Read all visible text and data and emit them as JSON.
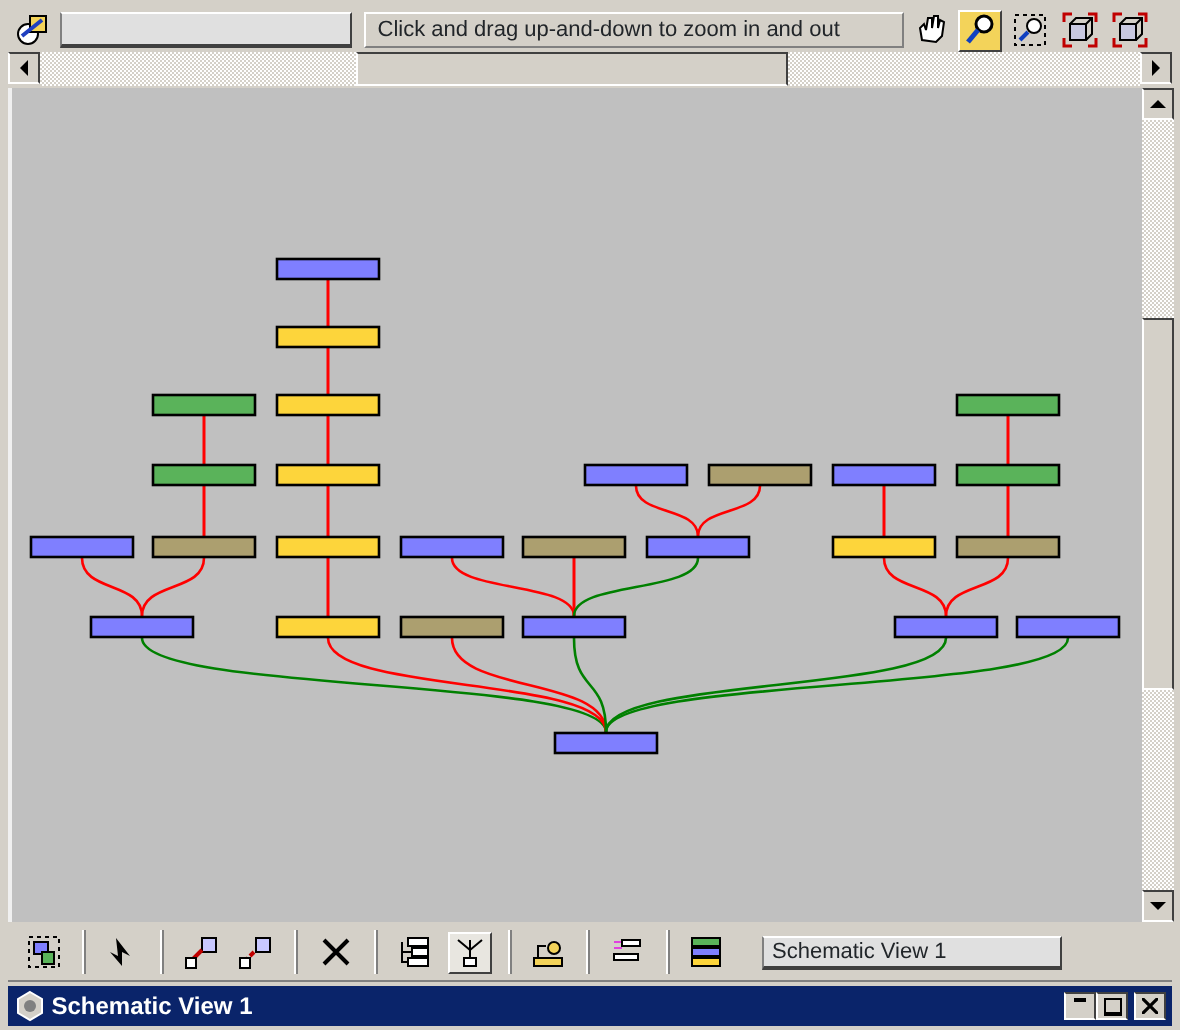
{
  "status_bar": {
    "field_text": "Click and drag up-and-down to zoom in and out"
  },
  "view_tools": [
    {
      "kind": "pan",
      "selected": false
    },
    {
      "kind": "zoom",
      "selected": true
    },
    {
      "kind": "zoom-region",
      "selected": false
    },
    {
      "kind": "zoom-extents-selected",
      "selected": false
    },
    {
      "kind": "zoom-extents",
      "selected": false
    }
  ],
  "graph": {
    "color": "#7f7fff",
    "children": [
      {
        "color": "#7f7fff",
        "link": {
          "color": "#008000"
        },
        "children": [
          {
            "color": "#7f7fff",
            "link": {
              "color": "#ff0000"
            }
          },
          {
            "color": "#ac9f6f",
            "link": {
              "color": "#ff0000"
            },
            "children": [
              {
                "color": "#5ab35a",
                "link": {
                  "color": "#ff0000"
                },
                "children": [
                  {
                    "color": "#5ab35a",
                    "link": {
                      "color": "#ff0000"
                    }
                  }
                ]
              }
            ]
          }
        ]
      },
      {
        "color": "#fdd53b",
        "link": {
          "color": "#ff0000"
        },
        "children": [
          {
            "color": "#fdd53b",
            "link": {
              "color": "#ff0000"
            },
            "children": [
              {
                "color": "#fdd53b",
                "link": {
                  "color": "#ff0000"
                },
                "children": [
                  {
                    "color": "#fdd53b",
                    "link": {
                      "color": "#ff0000"
                    },
                    "children": [
                      {
                        "color": "#fdd53b",
                        "link": {
                          "color": "#ff0000"
                        },
                        "children": [
                          {
                            "color": "#7f7fff",
                            "link": {
                              "color": "#ff0000"
                            }
                          }
                        ]
                      }
                    ]
                  }
                ]
              }
            ]
          }
        ]
      },
      {
        "color": "#ac9f6f",
        "link": {
          "color": "#ff0000"
        }
      },
      {
        "color": "#7f7fff",
        "link": {
          "color": "#008000"
        },
        "children": [
          {
            "color": "#7f7fff",
            "link": {
              "color": "#ff0000"
            }
          },
          {
            "color": "#ac9f6f",
            "link": {
              "color": "#ff0000"
            }
          },
          {
            "color": "#7f7fff",
            "link": {
              "color": "#008000"
            },
            "children": [
              {
                "color": "#7f7fff",
                "link": {
                  "color": "#ff0000"
                }
              },
              {
                "color": "#ac9f6f",
                "link": {
                  "color": "#ff0000"
                }
              }
            ]
          }
        ]
      },
      {
        "color": "#7f7fff",
        "link": {
          "color": "#008000"
        },
        "children": [
          {
            "color": "#fdd53b",
            "link": {
              "color": "#ff0000"
            },
            "children": [
              {
                "color": "#7f7fff",
                "link": {
                  "color": "#ff0000"
                }
              }
            ]
          },
          {
            "color": "#ac9f6f",
            "link": {
              "color": "#ff0000"
            },
            "children": [
              {
                "color": "#5ab35a",
                "link": {
                  "color": "#ff0000"
                },
                "children": [
                  {
                    "color": "#5ab35a",
                    "link": {
                      "color": "#ff0000"
                    }
                  }
                ]
              }
            ]
          }
        ]
      },
      {
        "color": "#7f7fff",
        "link": {
          "color": "#008000"
        }
      }
    ]
  },
  "toolbar": [
    [
      {
        "kind": "display",
        "selected": false
      }
    ],
    [
      {
        "kind": "select",
        "selected": false
      }
    ],
    [
      {
        "kind": "connect",
        "selected": false
      },
      {
        "kind": "unlink",
        "selected": false
      }
    ],
    [
      {
        "kind": "delete",
        "selected": false
      }
    ],
    [
      {
        "kind": "hierarchy",
        "selected": false
      },
      {
        "kind": "references",
        "selected": true
      }
    ],
    [
      {
        "kind": "move-children",
        "selected": false
      }
    ],
    [
      {
        "kind": "align",
        "selected": false
      }
    ],
    [
      {
        "kind": "list-views",
        "selected": false
      }
    ]
  ],
  "view_name": "Schematic View 1",
  "window": {
    "title": "Schematic View 1"
  }
}
